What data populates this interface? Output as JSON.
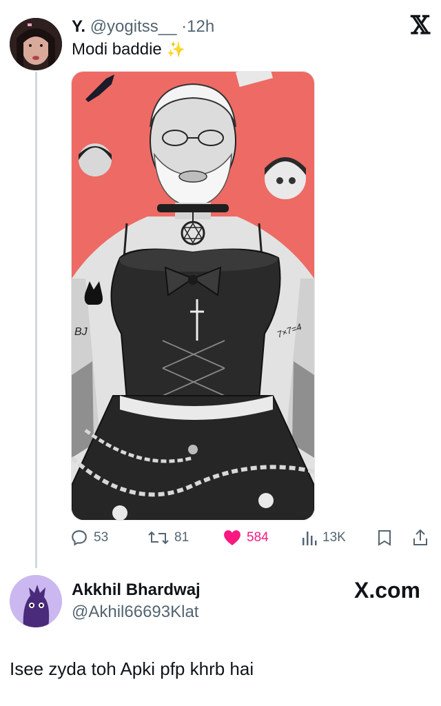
{
  "post": {
    "display_name": "Y.",
    "handle": "@yogitss__",
    "separator": "·",
    "time": "12h",
    "text": "Modi baddie",
    "emoji": "✨",
    "image_texts": {
      "arm_left": "BJ",
      "arm_right": "7×7=4"
    },
    "actions": {
      "replies": "53",
      "reposts": "81",
      "likes": "584",
      "views": "13K"
    },
    "icons": [
      "x-logo-icon",
      "reply-icon",
      "repost-icon",
      "heart-icon",
      "views-icon",
      "bookmark-icon",
      "share-icon"
    ],
    "like_color": "#f91880"
  },
  "reply": {
    "display_name": "Akkhil Bhardwaj",
    "handle": "@Akhil66693Klat",
    "brand": "X.com",
    "text": "Isee zyda toh Apki pfp khrb hai"
  }
}
